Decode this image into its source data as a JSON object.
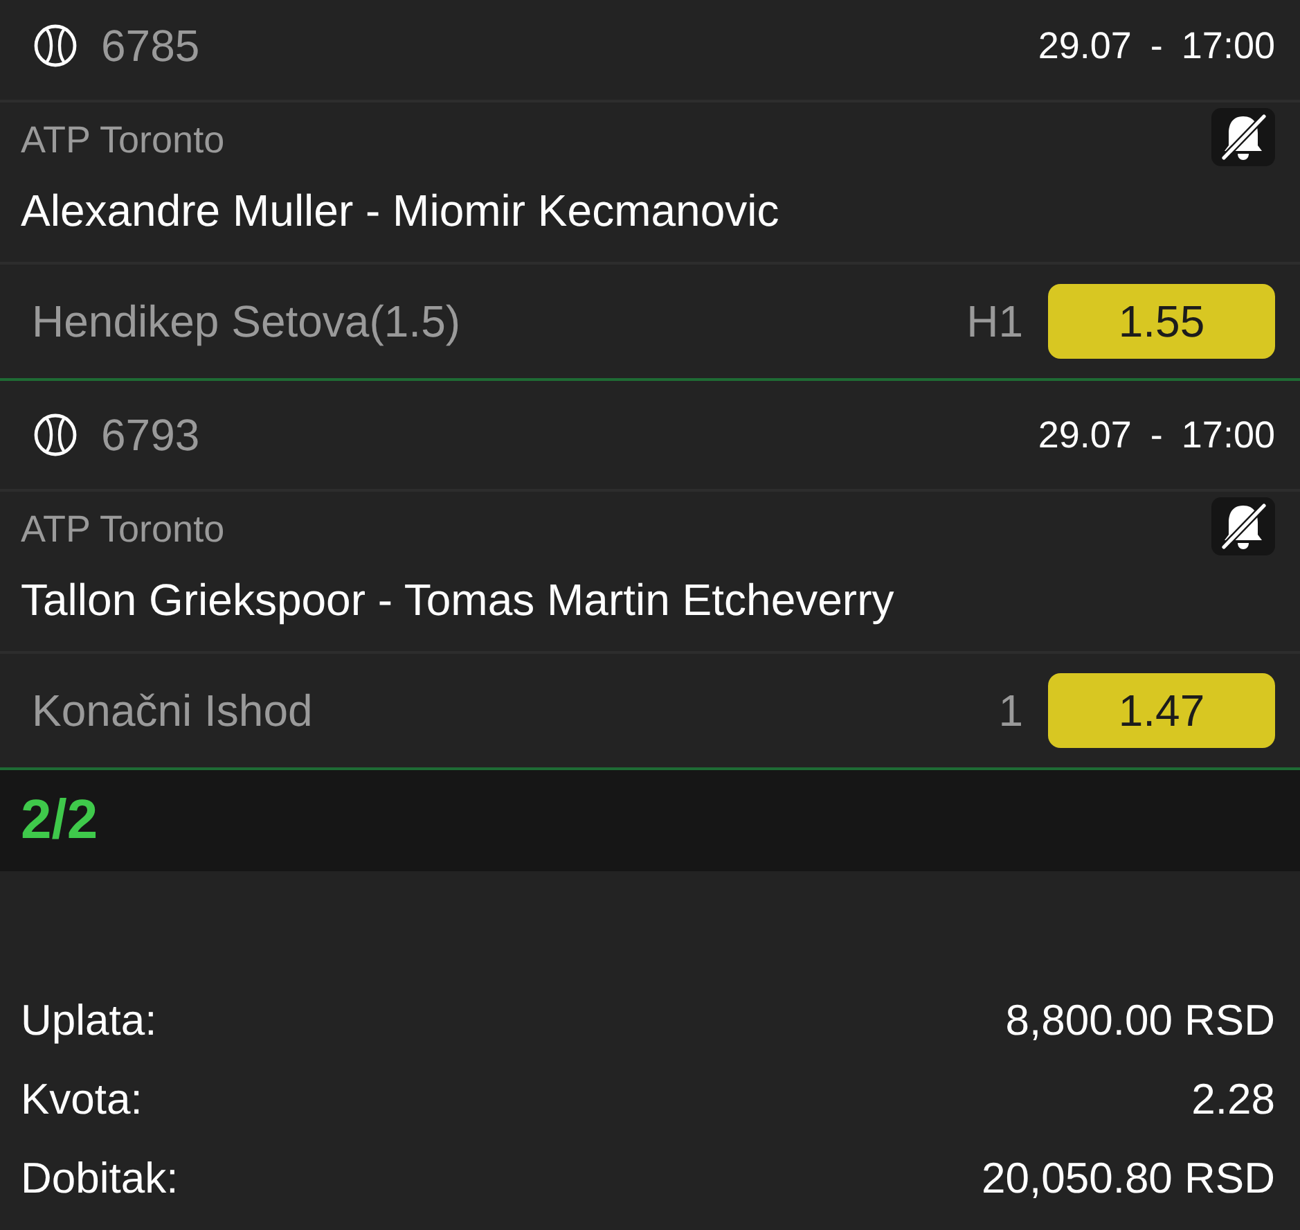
{
  "bets": [
    {
      "kind": "tennis",
      "event_number": "6785",
      "datetime": "29.07 - 17:00",
      "league": "ATP Toronto",
      "match": "Alexandre Muller - Miomir Kecmanovic",
      "notifications": false,
      "market": "Hendikep Setova(1.5)",
      "pick": "H1",
      "odds": "1.55"
    },
    {
      "kind": "tennis",
      "event_number": "6793",
      "datetime": "29.07 - 17:00",
      "league": "ATP Toronto",
      "match": "Tallon Griekspoor - Tomas Martin Etcheverry",
      "notifications": false,
      "market": "Konačni Ishod",
      "pick": "1",
      "odds": "1.47"
    }
  ],
  "summary": {
    "count": "2/2"
  },
  "totals": [
    {
      "label": "Uplata:",
      "value": "8,800.00 RSD"
    },
    {
      "label": "Kvota:",
      "value": "2.28"
    },
    {
      "label": "Dobitak:",
      "value": "20,050.80 RSD"
    }
  ]
}
